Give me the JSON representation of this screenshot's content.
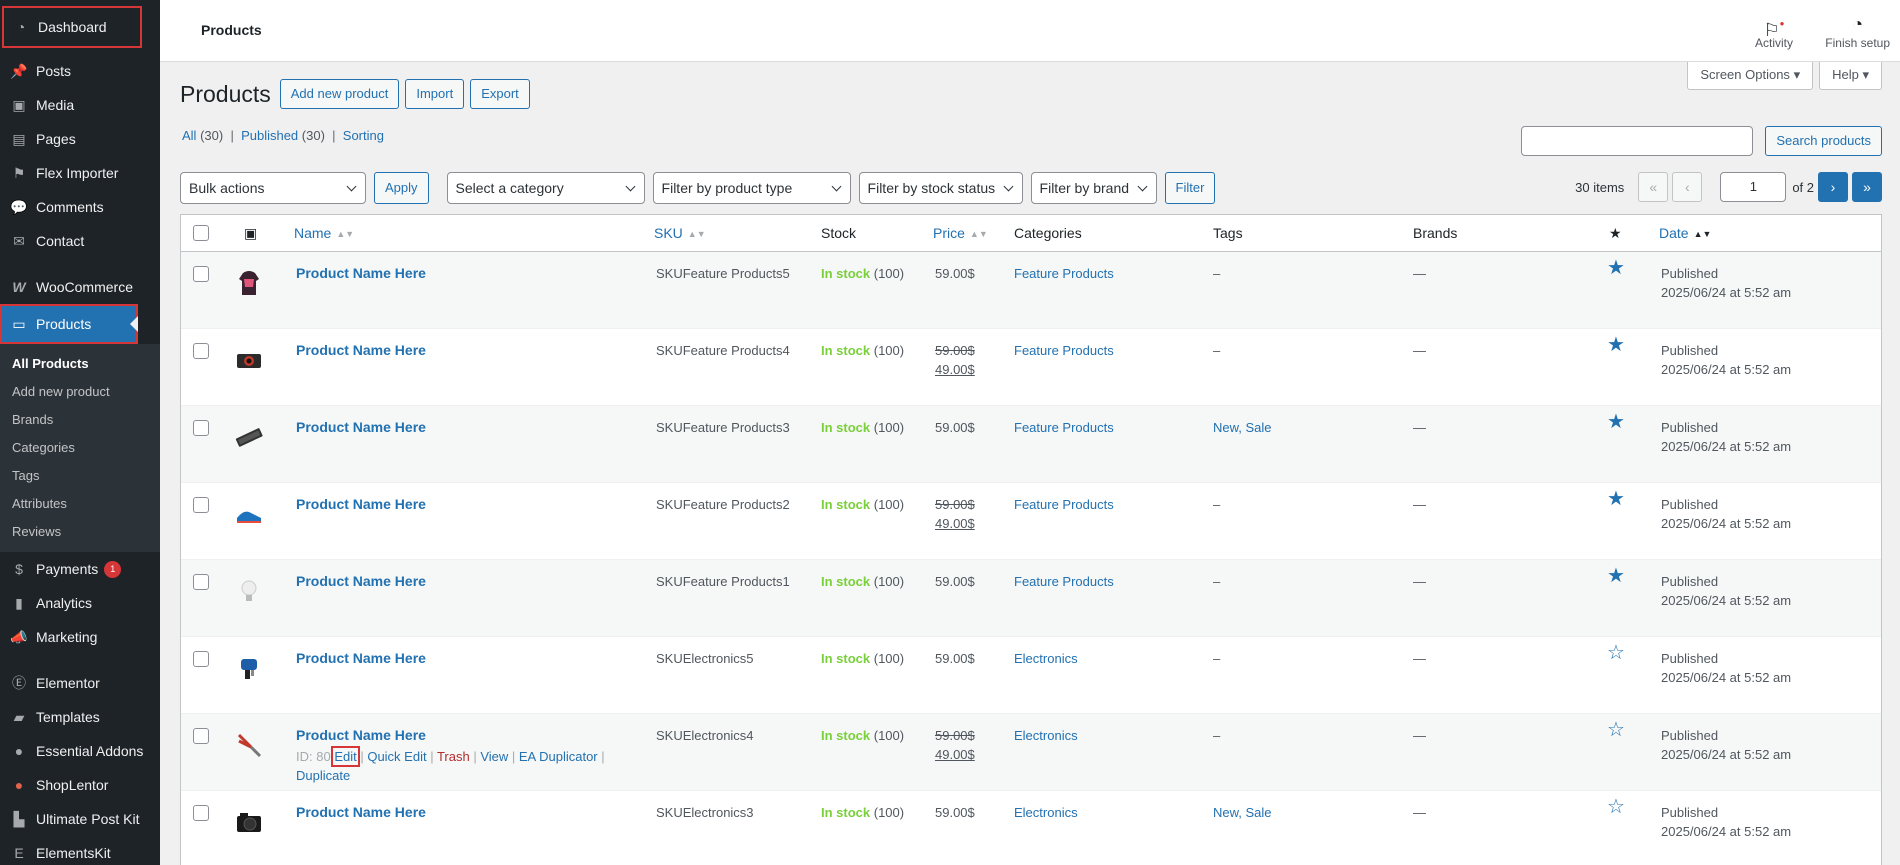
{
  "sidebar": {
    "items": [
      {
        "label": "Dashboard",
        "icon": "dashboard-icon"
      },
      {
        "label": "Posts",
        "icon": "pin-icon"
      },
      {
        "label": "Media",
        "icon": "media-icon"
      },
      {
        "label": "Pages",
        "icon": "pages-icon"
      },
      {
        "label": "Flex Importer",
        "icon": "importer-icon"
      },
      {
        "label": "Comments",
        "icon": "comment-icon"
      },
      {
        "label": "Contact",
        "icon": "mail-icon"
      },
      {
        "label": "WooCommerce",
        "icon": "woocommerce-icon"
      },
      {
        "label": "Products",
        "icon": "products-icon"
      },
      {
        "label": "Payments",
        "icon": "payments-icon",
        "badge": "1"
      },
      {
        "label": "Analytics",
        "icon": "analytics-icon"
      },
      {
        "label": "Marketing",
        "icon": "megaphone-icon"
      },
      {
        "label": "Elementor",
        "icon": "elementor-icon"
      },
      {
        "label": "Templates",
        "icon": "folder-icon"
      },
      {
        "label": "Essential Addons",
        "icon": "ea-icon"
      },
      {
        "label": "ShopLentor",
        "icon": "shoplentor-icon"
      },
      {
        "label": "Ultimate Post Kit",
        "icon": "postkit-icon"
      },
      {
        "label": "ElementsKit",
        "icon": "elementskit-icon"
      }
    ],
    "submenu": [
      "All Products",
      "Add new product",
      "Brands",
      "Categories",
      "Tags",
      "Attributes",
      "Reviews"
    ]
  },
  "topbar": {
    "page_label": "Products",
    "activity": "Activity",
    "finish_setup": "Finish setup"
  },
  "screen_options": "Screen Options",
  "help": "Help",
  "header": {
    "title": "Products",
    "add_new": "Add new product",
    "import": "Import",
    "export": "Export"
  },
  "views": {
    "all": "All",
    "all_count": "(30)",
    "published": "Published",
    "published_count": "(30)",
    "sorting": "Sorting"
  },
  "search": {
    "value": "",
    "button": "Search products"
  },
  "filters": {
    "bulk_actions": "Bulk actions",
    "apply": "Apply",
    "category": "Select a category",
    "product_type": "Filter by product type",
    "stock_status": "Filter by stock status",
    "brand": "Filter by brand",
    "filter": "Filter"
  },
  "pagination": {
    "items": "30 items",
    "first": "«",
    "prev": "‹",
    "current": "1",
    "of": "of 2",
    "next": "›",
    "last": "»"
  },
  "columns": {
    "name": "Name",
    "sku": "SKU",
    "stock": "Stock",
    "price": "Price",
    "categories": "Categories",
    "tags": "Tags",
    "brands": "Brands",
    "date": "Date"
  },
  "products": [
    {
      "name": "Product Name Here",
      "sku": "SKUFeature Products5",
      "stock": "In stock",
      "stock_qty": "(100)",
      "price": "59.00$",
      "regular_price": "",
      "sale_price": "",
      "category": "Feature Products",
      "tags": "–",
      "brands": "—",
      "featured": true,
      "status": "Published",
      "date": "2025/06/24 at 5:52 am",
      "thumb": "hoodie-icon"
    },
    {
      "name": "Product Name Here",
      "sku": "SKUFeature Products4",
      "stock": "In stock",
      "stock_qty": "(100)",
      "price": "",
      "regular_price": "59.00$",
      "sale_price": "49.00$",
      "category": "Feature Products",
      "tags": "–",
      "brands": "—",
      "featured": true,
      "status": "Published",
      "date": "2025/06/24 at 5:52 am",
      "thumb": "camera-icon"
    },
    {
      "name": "Product Name Here",
      "sku": "SKUFeature Products3",
      "stock": "In stock",
      "stock_qty": "(100)",
      "price": "59.00$",
      "regular_price": "",
      "sale_price": "",
      "category": "Feature Products",
      "tags": "New, Sale",
      "brands": "—",
      "featured": true,
      "status": "Published",
      "date": "2025/06/24 at 5:52 am",
      "thumb": "keyboard-icon"
    },
    {
      "name": "Product Name Here",
      "sku": "SKUFeature Products2",
      "stock": "In stock",
      "stock_qty": "(100)",
      "price": "",
      "regular_price": "59.00$",
      "sale_price": "49.00$",
      "category": "Feature Products",
      "tags": "–",
      "brands": "—",
      "featured": true,
      "status": "Published",
      "date": "2025/06/24 at 5:52 am",
      "thumb": "sneaker-icon"
    },
    {
      "name": "Product Name Here",
      "sku": "SKUFeature Products1",
      "stock": "In stock",
      "stock_qty": "(100)",
      "price": "59.00$",
      "regular_price": "",
      "sale_price": "",
      "category": "Feature Products",
      "tags": "–",
      "brands": "—",
      "featured": true,
      "status": "Published",
      "date": "2025/06/24 at 5:52 am",
      "thumb": "lightbulb-icon"
    },
    {
      "name": "Product Name Here",
      "sku": "SKUElectronics5",
      "stock": "In stock",
      "stock_qty": "(100)",
      "price": "59.00$",
      "regular_price": "",
      "sale_price": "",
      "category": "Electronics",
      "tags": "–",
      "brands": "—",
      "featured": false,
      "status": "Published",
      "date": "2025/06/24 at 5:52 am",
      "thumb": "jigsaw-icon"
    },
    {
      "name": "Product Name Here",
      "sku": "SKUElectronics4",
      "stock": "In stock",
      "stock_qty": "(100)",
      "price": "",
      "regular_price": "59.00$",
      "sale_price": "49.00$",
      "category": "Electronics",
      "tags": "–",
      "brands": "—",
      "featured": false,
      "status": "Published",
      "date": "2025/06/24 at 5:52 am",
      "thumb": "pliers-icon",
      "row_actions": {
        "id": "ID: 80",
        "edit": "Edit",
        "quick_edit": "Quick Edit",
        "trash": "Trash",
        "view": "View",
        "ea_duplicator": "EA Duplicator",
        "duplicate": "Duplicate"
      }
    },
    {
      "name": "Product Name Here",
      "sku": "SKUElectronics3",
      "stock": "In stock",
      "stock_qty": "(100)",
      "price": "59.00$",
      "regular_price": "",
      "sale_price": "",
      "category": "Electronics",
      "tags": "New, Sale",
      "brands": "—",
      "featured": false,
      "status": "Published",
      "date": "2025/06/24 at 5:52 am",
      "thumb": "dslr-icon"
    }
  ],
  "colors": {
    "accent": "#2271b1",
    "sidebar_bg": "#1d2327",
    "in_stock": "#7ad03a",
    "highlight": "#d63638"
  }
}
